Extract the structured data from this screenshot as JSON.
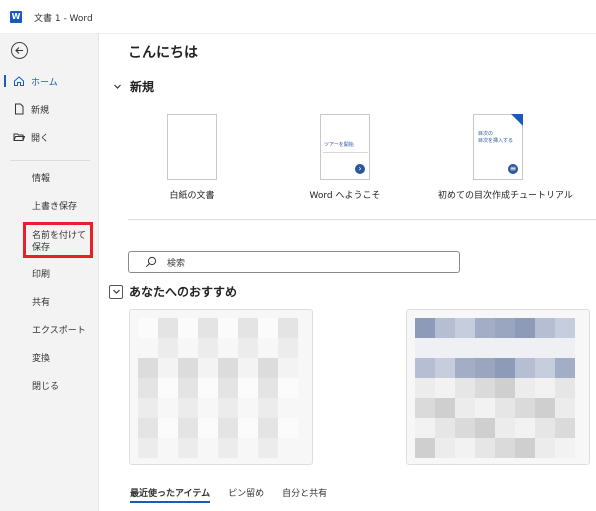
{
  "window": {
    "app_letter": "W",
    "title": "文書 1 - Word"
  },
  "sidebar": {
    "primary": [
      {
        "label": "ホーム",
        "icon": "home-icon",
        "active": true
      },
      {
        "label": "新規",
        "icon": "new-document-icon"
      },
      {
        "label": "開く",
        "icon": "open-folder-icon"
      }
    ],
    "secondary": [
      "情報",
      "上書き保存",
      "名前を付けて保存",
      "印刷",
      "共有",
      "エクスポート",
      "変換",
      "閉じる"
    ]
  },
  "main": {
    "greeting": "こんにちは",
    "new_section": "新規",
    "templates": [
      {
        "label": "白紙の文書"
      },
      {
        "label": "Word へようこそ",
        "thumb_text": "ツアーを開始"
      },
      {
        "label": "初めての目次作成チュートリアル",
        "thumb_text": "目次の\n目次を挿入する"
      }
    ],
    "search_placeholder": "検索",
    "recommended_section": "あなたへのおすすめ",
    "tabs": [
      "最近使ったアイテム",
      "ピン留め",
      "自分と共有"
    ]
  },
  "colors": {
    "accent": "#185abd",
    "highlight": "#e8202a"
  }
}
